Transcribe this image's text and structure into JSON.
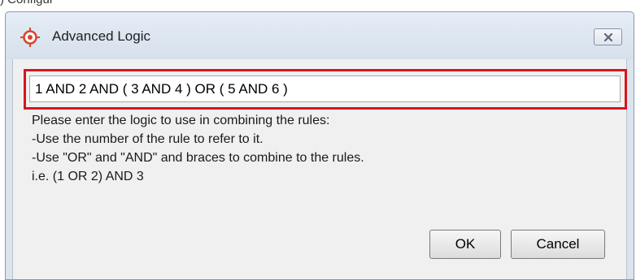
{
  "crop_caption": ") Configur",
  "dialog": {
    "title": "Advanced Logic",
    "icon": "target-crosshair-icon",
    "close_icon": "close-icon"
  },
  "logic_input": {
    "value": "1 AND 2 AND ( 3 AND 4 ) OR ( 5 AND 6 )"
  },
  "help_lines": [
    "Please enter the logic to use in combining the rules:",
    "-Use the number of the rule to refer to it.",
    "-Use \"OR\" and \"AND\" and braces to combine to the rules.",
    "i.e. (1 OR 2) AND 3"
  ],
  "buttons": {
    "ok": "OK",
    "cancel": "Cancel"
  },
  "colors": {
    "highlight": "#d6161c",
    "icon_red": "#d8462f"
  }
}
